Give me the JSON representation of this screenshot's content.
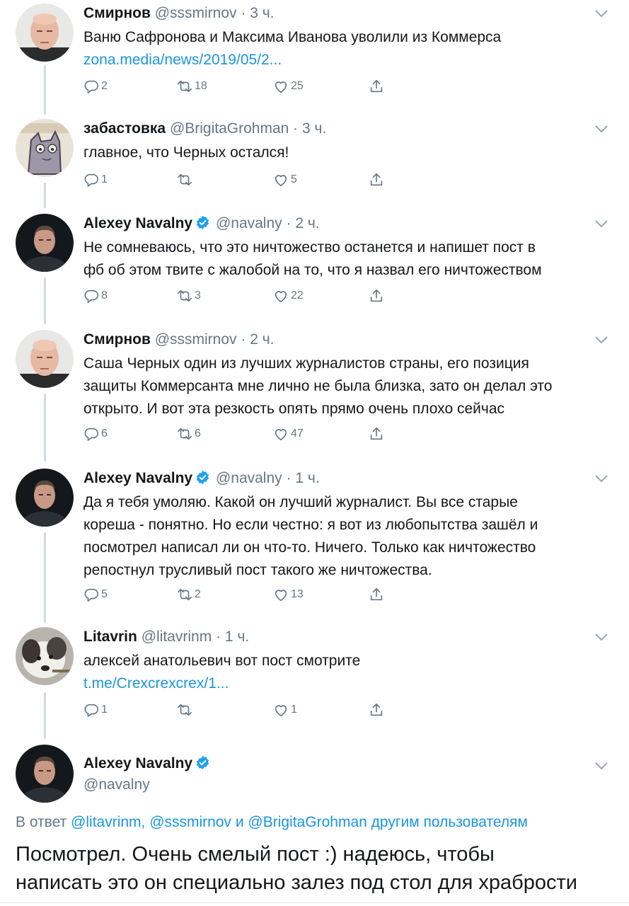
{
  "tweets": [
    {
      "name": "Смирнов",
      "handle": "@sssmirnov",
      "time": "3 ч.",
      "avatar": "avatar-bald-man",
      "lines": [
        "Ваню Сафронова и Максима Иванова уволили из Коммерса"
      ],
      "link": "zona.media/news/2019/05/2...",
      "replies": "2",
      "retweets": "18",
      "likes": "25"
    },
    {
      "name": "забастовка",
      "handle": "@BrigitaGrohman",
      "time": "3 ч.",
      "avatar": "avatar-cat-drawing",
      "lines": [
        "главное, что Черных остался!"
      ],
      "replies": "1",
      "retweets": "",
      "likes": "5"
    },
    {
      "name": "Alexey Navalny",
      "handle": "@navalny",
      "time": "2 ч.",
      "verified": true,
      "avatar": "avatar-man-dark",
      "lines": [
        "Не сомневаюсь, что это ничтожество останется и напишет пост в",
        "фб об этом твите с жалобой на то, что я назвал его ничтожеством"
      ],
      "replies": "8",
      "retweets": "3",
      "likes": "22"
    },
    {
      "name": "Смирнов",
      "handle": "@sssmirnov",
      "time": "2 ч.",
      "avatar": "avatar-bald-man",
      "lines": [
        "Саша Черных один из лучших журналистов страны, его позиция",
        "защиты Коммерсанта мне лично не была близка, зато он делал это",
        "открыто. И вот эта резкость опять прямо очень плохо сейчас"
      ],
      "replies": "6",
      "retweets": "6",
      "likes": "47"
    },
    {
      "name": "Alexey Navalny",
      "handle": "@navalny",
      "time": "1 ч.",
      "verified": true,
      "avatar": "avatar-man-dark",
      "lines": [
        "Да я тебя умоляю. Какой он лучший журналист. Вы все старые",
        "кореша - понятно. Но если честно: я вот из любопытства зашёл и",
        "посмотрел написал ли он что-то. Ничего. Только как ничтожество",
        "репостнул трусливый пост такого же ничтожества."
      ],
      "replies": "5",
      "retweets": "2",
      "likes": "13"
    },
    {
      "name": "Litavrin",
      "handle": "@litavrinm",
      "time": "1 ч.",
      "avatar": "avatar-dog",
      "lines": [
        "алексей анатольевич вот пост смотрите"
      ],
      "link": "t.me/Crexcrexcrex/1...",
      "replies": "1",
      "retweets": "",
      "likes": "1"
    }
  ],
  "final": {
    "name": "Alexey Navalny",
    "handle": "@navalny",
    "verified": true,
    "reply_prefix": "В ответ",
    "reply_mentions": "@litavrinm, @sssmirnov и @BrigitaGrohman другим пользователям",
    "lines": [
      "Посмотрел. Очень смелый пост :) надеюсь, чтобы",
      "написать это он специально залез под стол для храбрости"
    ]
  },
  "icons": {
    "reply": "reply-icon",
    "retweet": "retweet-icon",
    "like": "heart-icon",
    "share": "share-icon",
    "more": "chevron-down-icon",
    "verified": "verified-badge-icon"
  },
  "colors": {
    "link": "#1b95e0",
    "secondary": "#657786",
    "verified": "#1da1f2",
    "thread": "#cfd9de"
  }
}
